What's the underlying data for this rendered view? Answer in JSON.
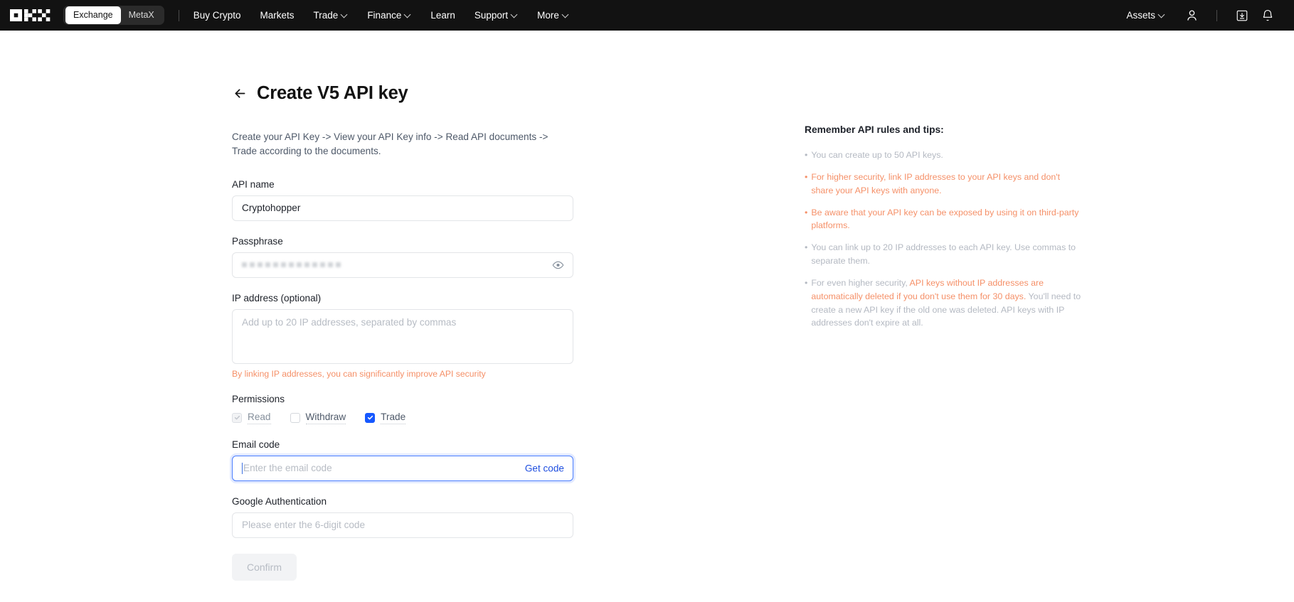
{
  "nav": {
    "logo_name": "okx-logo",
    "segments": [
      {
        "label": "Exchange",
        "active": true
      },
      {
        "label": "MetaX",
        "active": false
      }
    ],
    "links": [
      {
        "label": "Buy Crypto",
        "caret": false
      },
      {
        "label": "Markets",
        "caret": false
      },
      {
        "label": "Trade",
        "caret": true
      },
      {
        "label": "Finance",
        "caret": true
      },
      {
        "label": "Learn",
        "caret": false
      },
      {
        "label": "Support",
        "caret": true
      },
      {
        "label": "More",
        "caret": true
      }
    ],
    "assets_label": "Assets",
    "icons": [
      "user-icon",
      "download-icon",
      "bell-icon"
    ]
  },
  "page": {
    "title": "Create V5 API key",
    "back_icon": "back-arrow-icon",
    "intro": "Create your API Key -> View your API Key info -> Read API documents -> Trade according to the documents."
  },
  "form": {
    "api_name": {
      "label": "API name",
      "value": "Cryptohopper"
    },
    "passphrase": {
      "label": "Passphrase",
      "masked_char_count": 13,
      "toggle_icon": "eye-icon"
    },
    "ip_address": {
      "label": "IP address (optional)",
      "placeholder": "Add up to 20 IP addresses, separated by commas",
      "hint": "By linking IP addresses, you can significantly improve API security"
    },
    "permissions": {
      "label": "Permissions",
      "items": [
        {
          "label": "Read",
          "state": "checked-disabled"
        },
        {
          "label": "Withdraw",
          "state": "unchecked"
        },
        {
          "label": "Trade",
          "state": "checked"
        }
      ]
    },
    "email_code": {
      "label": "Email code",
      "placeholder": "Enter the email code",
      "value": "",
      "action_label": "Get code",
      "focused": true
    },
    "google_auth": {
      "label": "Google Authentication",
      "placeholder": "Please enter the 6-digit code",
      "value": ""
    },
    "submit_label": "Confirm"
  },
  "tips": {
    "title": "Remember API rules and tips:",
    "items": [
      {
        "style": "gray",
        "parts": [
          {
            "text": "You can create up to 50 API keys.",
            "color": "gray"
          }
        ]
      },
      {
        "style": "orange",
        "parts": [
          {
            "text": "For higher security, link IP addresses to your API keys and don't share your API keys with anyone.",
            "color": "orange"
          }
        ]
      },
      {
        "style": "orange",
        "parts": [
          {
            "text": "Be aware that your API key can be exposed by using it on third-party platforms.",
            "color": "orange"
          }
        ]
      },
      {
        "style": "gray",
        "parts": [
          {
            "text": "You can link up to 20 IP addresses to each API key. Use commas to separate them.",
            "color": "gray"
          }
        ]
      },
      {
        "style": "gray",
        "parts": [
          {
            "text": "For even higher security, ",
            "color": "gray"
          },
          {
            "text": "API keys without IP addresses are automatically deleted if you don't use them for 30 days.",
            "color": "orange"
          },
          {
            "text": " You'll need to create a new API key if the old one was deleted. API keys with IP addresses don't expire at all.",
            "color": "gray"
          }
        ]
      }
    ]
  },
  "colors": {
    "nav_bg": "#121212",
    "accent_blue": "#1658ff",
    "link_blue": "#1f4fe0",
    "warn_orange": "#f59068",
    "muted_gray": "#b4b9c2"
  }
}
